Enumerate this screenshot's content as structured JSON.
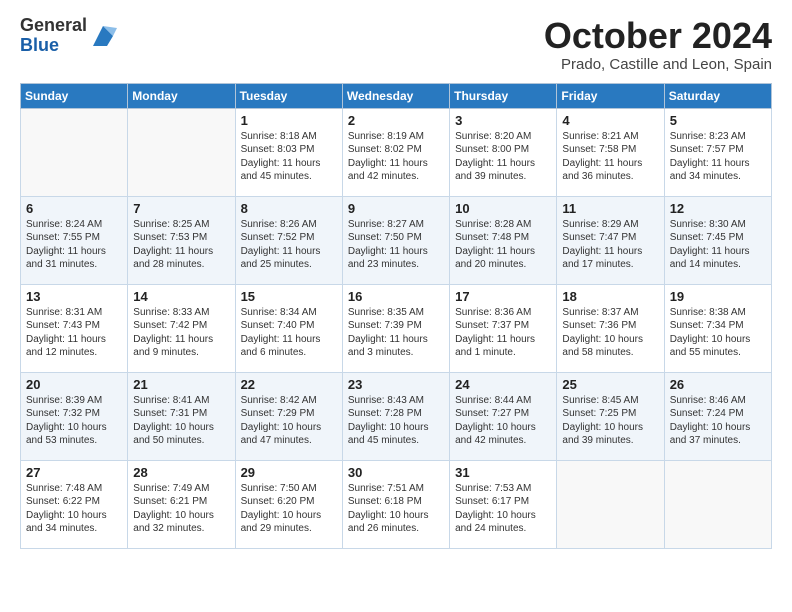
{
  "logo": {
    "general": "General",
    "blue": "Blue"
  },
  "title": "October 2024",
  "location": "Prado, Castille and Leon, Spain",
  "headers": [
    "Sunday",
    "Monday",
    "Tuesday",
    "Wednesday",
    "Thursday",
    "Friday",
    "Saturday"
  ],
  "weeks": [
    [
      {
        "num": "",
        "detail": ""
      },
      {
        "num": "",
        "detail": ""
      },
      {
        "num": "1",
        "detail": "Sunrise: 8:18 AM\nSunset: 8:03 PM\nDaylight: 11 hours\nand 45 minutes."
      },
      {
        "num": "2",
        "detail": "Sunrise: 8:19 AM\nSunset: 8:02 PM\nDaylight: 11 hours\nand 42 minutes."
      },
      {
        "num": "3",
        "detail": "Sunrise: 8:20 AM\nSunset: 8:00 PM\nDaylight: 11 hours\nand 39 minutes."
      },
      {
        "num": "4",
        "detail": "Sunrise: 8:21 AM\nSunset: 7:58 PM\nDaylight: 11 hours\nand 36 minutes."
      },
      {
        "num": "5",
        "detail": "Sunrise: 8:23 AM\nSunset: 7:57 PM\nDaylight: 11 hours\nand 34 minutes."
      }
    ],
    [
      {
        "num": "6",
        "detail": "Sunrise: 8:24 AM\nSunset: 7:55 PM\nDaylight: 11 hours\nand 31 minutes."
      },
      {
        "num": "7",
        "detail": "Sunrise: 8:25 AM\nSunset: 7:53 PM\nDaylight: 11 hours\nand 28 minutes."
      },
      {
        "num": "8",
        "detail": "Sunrise: 8:26 AM\nSunset: 7:52 PM\nDaylight: 11 hours\nand 25 minutes."
      },
      {
        "num": "9",
        "detail": "Sunrise: 8:27 AM\nSunset: 7:50 PM\nDaylight: 11 hours\nand 23 minutes."
      },
      {
        "num": "10",
        "detail": "Sunrise: 8:28 AM\nSunset: 7:48 PM\nDaylight: 11 hours\nand 20 minutes."
      },
      {
        "num": "11",
        "detail": "Sunrise: 8:29 AM\nSunset: 7:47 PM\nDaylight: 11 hours\nand 17 minutes."
      },
      {
        "num": "12",
        "detail": "Sunrise: 8:30 AM\nSunset: 7:45 PM\nDaylight: 11 hours\nand 14 minutes."
      }
    ],
    [
      {
        "num": "13",
        "detail": "Sunrise: 8:31 AM\nSunset: 7:43 PM\nDaylight: 11 hours\nand 12 minutes."
      },
      {
        "num": "14",
        "detail": "Sunrise: 8:33 AM\nSunset: 7:42 PM\nDaylight: 11 hours\nand 9 minutes."
      },
      {
        "num": "15",
        "detail": "Sunrise: 8:34 AM\nSunset: 7:40 PM\nDaylight: 11 hours\nand 6 minutes."
      },
      {
        "num": "16",
        "detail": "Sunrise: 8:35 AM\nSunset: 7:39 PM\nDaylight: 11 hours\nand 3 minutes."
      },
      {
        "num": "17",
        "detail": "Sunrise: 8:36 AM\nSunset: 7:37 PM\nDaylight: 11 hours\nand 1 minute."
      },
      {
        "num": "18",
        "detail": "Sunrise: 8:37 AM\nSunset: 7:36 PM\nDaylight: 10 hours\nand 58 minutes."
      },
      {
        "num": "19",
        "detail": "Sunrise: 8:38 AM\nSunset: 7:34 PM\nDaylight: 10 hours\nand 55 minutes."
      }
    ],
    [
      {
        "num": "20",
        "detail": "Sunrise: 8:39 AM\nSunset: 7:32 PM\nDaylight: 10 hours\nand 53 minutes."
      },
      {
        "num": "21",
        "detail": "Sunrise: 8:41 AM\nSunset: 7:31 PM\nDaylight: 10 hours\nand 50 minutes."
      },
      {
        "num": "22",
        "detail": "Sunrise: 8:42 AM\nSunset: 7:29 PM\nDaylight: 10 hours\nand 47 minutes."
      },
      {
        "num": "23",
        "detail": "Sunrise: 8:43 AM\nSunset: 7:28 PM\nDaylight: 10 hours\nand 45 minutes."
      },
      {
        "num": "24",
        "detail": "Sunrise: 8:44 AM\nSunset: 7:27 PM\nDaylight: 10 hours\nand 42 minutes."
      },
      {
        "num": "25",
        "detail": "Sunrise: 8:45 AM\nSunset: 7:25 PM\nDaylight: 10 hours\nand 39 minutes."
      },
      {
        "num": "26",
        "detail": "Sunrise: 8:46 AM\nSunset: 7:24 PM\nDaylight: 10 hours\nand 37 minutes."
      }
    ],
    [
      {
        "num": "27",
        "detail": "Sunrise: 7:48 AM\nSunset: 6:22 PM\nDaylight: 10 hours\nand 34 minutes."
      },
      {
        "num": "28",
        "detail": "Sunrise: 7:49 AM\nSunset: 6:21 PM\nDaylight: 10 hours\nand 32 minutes."
      },
      {
        "num": "29",
        "detail": "Sunrise: 7:50 AM\nSunset: 6:20 PM\nDaylight: 10 hours\nand 29 minutes."
      },
      {
        "num": "30",
        "detail": "Sunrise: 7:51 AM\nSunset: 6:18 PM\nDaylight: 10 hours\nand 26 minutes."
      },
      {
        "num": "31",
        "detail": "Sunrise: 7:53 AM\nSunset: 6:17 PM\nDaylight: 10 hours\nand 24 minutes."
      },
      {
        "num": "",
        "detail": ""
      },
      {
        "num": "",
        "detail": ""
      }
    ]
  ]
}
